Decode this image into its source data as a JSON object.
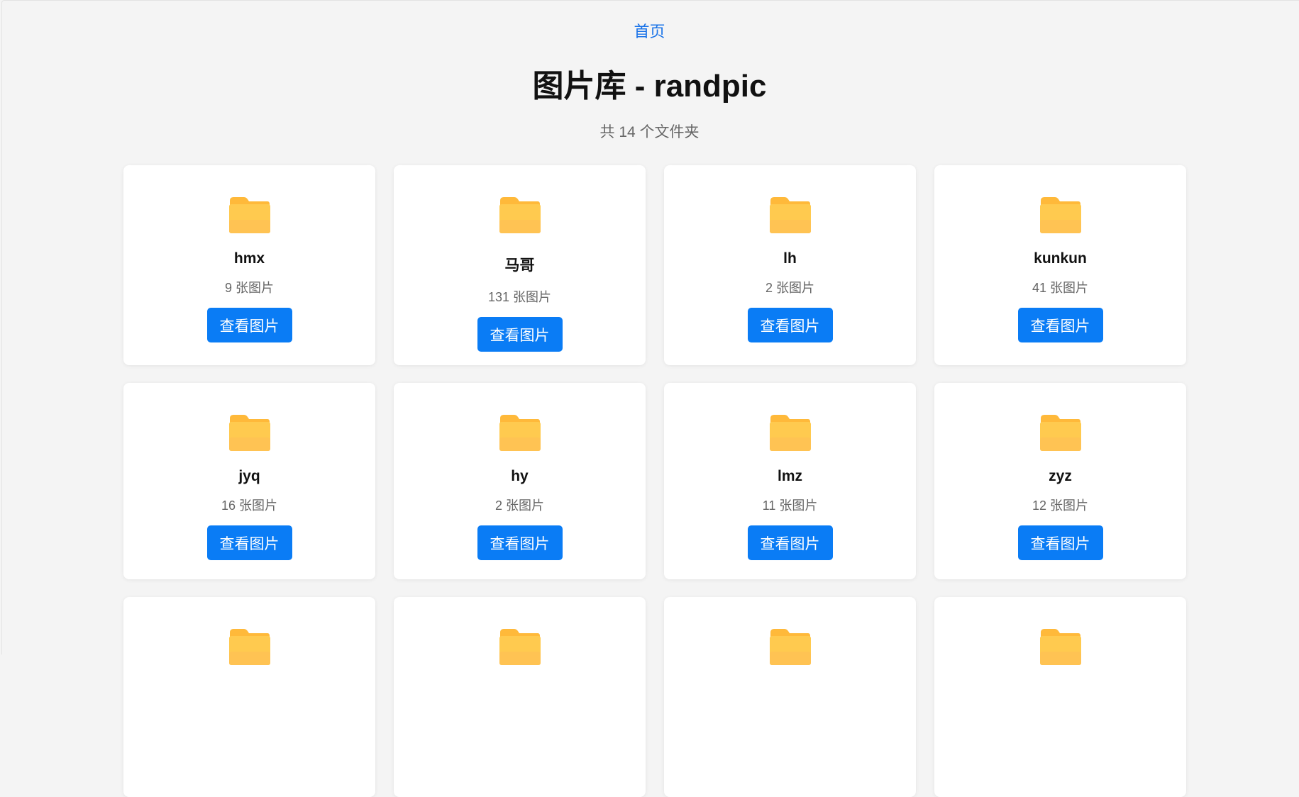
{
  "nav": {
    "home_label": "首页"
  },
  "header": {
    "title": "图片库 - randpic",
    "folder_count_text": "共 14 个文件夹"
  },
  "folders": [
    {
      "name": "hmx",
      "count": "9 张图片",
      "button": "查看图片"
    },
    {
      "name": "马哥",
      "count": "131 张图片",
      "button": "查看图片"
    },
    {
      "name": "lh",
      "count": "2 张图片",
      "button": "查看图片"
    },
    {
      "name": "kunkun",
      "count": "41 张图片",
      "button": "查看图片"
    },
    {
      "name": "jyq",
      "count": "16 张图片",
      "button": "查看图片"
    },
    {
      "name": "hy",
      "count": "2 张图片",
      "button": "查看图片"
    },
    {
      "name": "lmz",
      "count": "11 张图片",
      "button": "查看图片"
    },
    {
      "name": "zyz",
      "count": "12 张图片",
      "button": "查看图片"
    }
  ],
  "icons": {
    "folder": "folder-icon"
  },
  "colors": {
    "accent": "#0a7cf5",
    "link": "#1a73e8",
    "folder_top": "#ffc547",
    "folder_bottom": "#ffb74d"
  }
}
